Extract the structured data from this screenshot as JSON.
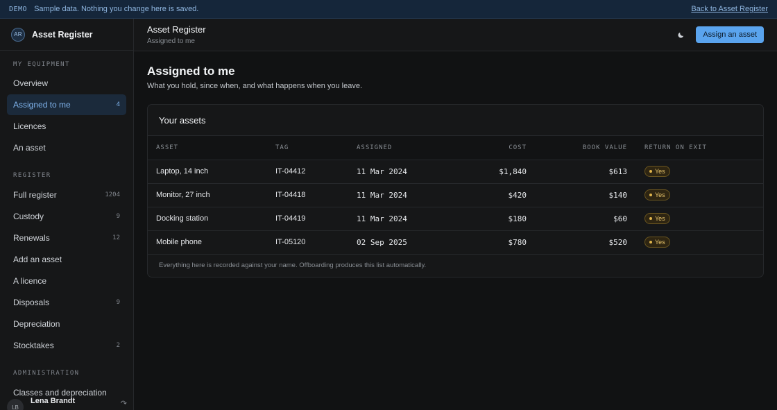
{
  "banner": {
    "tag": "DEMO",
    "message": "Sample data. Nothing you change here is saved.",
    "back_link": "Back to Asset Register"
  },
  "brand": {
    "initials": "AR",
    "name": "Asset Register"
  },
  "sidebar": {
    "sections": [
      {
        "label": "MY EQUIPMENT",
        "items": [
          {
            "label": "Overview",
            "count": ""
          },
          {
            "label": "Assigned to me",
            "count": "4",
            "active": true
          },
          {
            "label": "Licences",
            "count": ""
          },
          {
            "label": "An asset",
            "count": ""
          }
        ]
      },
      {
        "label": "REGISTER",
        "items": [
          {
            "label": "Full register",
            "count": "1204"
          },
          {
            "label": "Custody",
            "count": "9"
          },
          {
            "label": "Renewals",
            "count": "12"
          },
          {
            "label": "Add an asset",
            "count": ""
          },
          {
            "label": "A licence",
            "count": ""
          },
          {
            "label": "Disposals",
            "count": "9"
          },
          {
            "label": "Depreciation",
            "count": ""
          },
          {
            "label": "Stocktakes",
            "count": "2"
          }
        ]
      },
      {
        "label": "ADMINISTRATION",
        "items": [
          {
            "label": "Classes and depreciation",
            "count": ""
          }
        ]
      }
    ],
    "user": {
      "initials": "LB",
      "name": "Lena Brandt"
    }
  },
  "header": {
    "title": "Asset Register",
    "subtitle": "Assigned to me",
    "theme_icon": "moon-icon",
    "primary_button": "Assign an asset"
  },
  "page": {
    "title": "Assigned to me",
    "subtitle": "What you hold, since when, and what happens when you leave."
  },
  "card": {
    "title": "Your assets",
    "columns": [
      "ASSET",
      "TAG",
      "ASSIGNED",
      "COST",
      "BOOK VALUE",
      "RETURN ON EXIT"
    ],
    "rows": [
      {
        "asset": "Laptop, 14 inch",
        "tag": "IT-04412",
        "assigned": "11 Mar 2024",
        "cost": "$1,840",
        "book": "$613",
        "ret": "Yes"
      },
      {
        "asset": "Monitor, 27 inch",
        "tag": "IT-04418",
        "assigned": "11 Mar 2024",
        "cost": "$420",
        "book": "$140",
        "ret": "Yes"
      },
      {
        "asset": "Docking station",
        "tag": "IT-04419",
        "assigned": "11 Mar 2024",
        "cost": "$180",
        "book": "$60",
        "ret": "Yes"
      },
      {
        "asset": "Mobile phone",
        "tag": "IT-05120",
        "assigned": "02 Sep 2025",
        "cost": "$780",
        "book": "$520",
        "ret": "Yes"
      }
    ],
    "footer": "Everything here is recorded against your name. Offboarding produces this list automatically."
  },
  "colors": {
    "accent": "#5aa4ee",
    "active_nav_bg": "#1b2a3b",
    "badge_text": "#e6c36a",
    "banner_bg": "#15263a"
  }
}
